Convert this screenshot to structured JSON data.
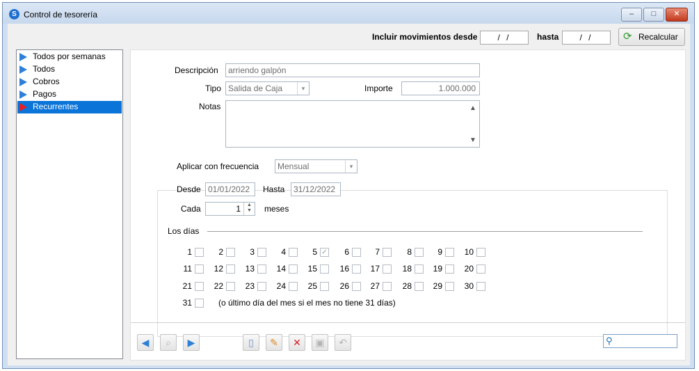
{
  "window": {
    "title": "Control de tesorería",
    "controls": {
      "minimize": "–",
      "maximize": "□",
      "close": "✕"
    }
  },
  "toolbar": {
    "incluir_label": "Incluir movimientos desde",
    "desde_value": "/ /",
    "hasta_label": "hasta",
    "hasta_value": "/ /",
    "recalcular_label": "Recalcular"
  },
  "tree": {
    "items": [
      {
        "label": "Todos por semanas"
      },
      {
        "label": "Todos"
      },
      {
        "label": "Cobros"
      },
      {
        "label": "Pagos"
      },
      {
        "label": "Recurrentes"
      }
    ],
    "selected": "Recurrentes"
  },
  "form": {
    "descripcion_label": "Descripción",
    "descripcion_value": "arriendo galpón",
    "tipo_label": "Tipo",
    "tipo_value": "Salida de Caja",
    "importe_label": "Importe",
    "importe_value": "1.000.000",
    "notas_label": "Notas",
    "notas_value": ""
  },
  "frecuencia": {
    "label": "Aplicar con frecuencia",
    "value": "Mensual",
    "desde_label": "Desde",
    "desde_value": "01/01/2022",
    "hasta_label": "Hasta",
    "hasta_value": "31/12/2022",
    "cada_label": "Cada",
    "cada_value": "1",
    "meses_label": "meses",
    "los_dias_label": "Los días",
    "checked_days": [
      5
    ],
    "last_day_note": "(o último día del mes si el mes no tiene 31 días)"
  },
  "days": {
    "d1": "1",
    "d2": "2",
    "d3": "3",
    "d4": "4",
    "d5": "5",
    "d6": "6",
    "d7": "7",
    "d8": "8",
    "d9": "9",
    "d10": "10",
    "d11": "11",
    "d12": "12",
    "d13": "13",
    "d14": "14",
    "d15": "15",
    "d16": "16",
    "d17": "17",
    "d18": "18",
    "d19": "19",
    "d20": "20",
    "d21": "21",
    "d22": "22",
    "d23": "23",
    "d24": "24",
    "d25": "25",
    "d26": "26",
    "d27": "27",
    "d28": "28",
    "d29": "29",
    "d30": "30",
    "d31": "31"
  },
  "glyphs": {
    "check": "✓",
    "combo_arrow": "▾",
    "scroll_up": "▲",
    "scroll_down": "▼",
    "spin_up": "▲",
    "spin_down": "▼",
    "recalc_icon": "⟳",
    "prev": "◀",
    "find": "⌕",
    "next": "▶",
    "new": "▯",
    "edit": "✎",
    "delete": "✕",
    "save": "▣",
    "undo": "↶",
    "search": "⚲"
  },
  "colors": {
    "selection": "#0a74d9",
    "tree_arrow": "#2d7fd8",
    "tree_arrow_selected": "#e0202a",
    "title_bar": "#cfdff1"
  }
}
